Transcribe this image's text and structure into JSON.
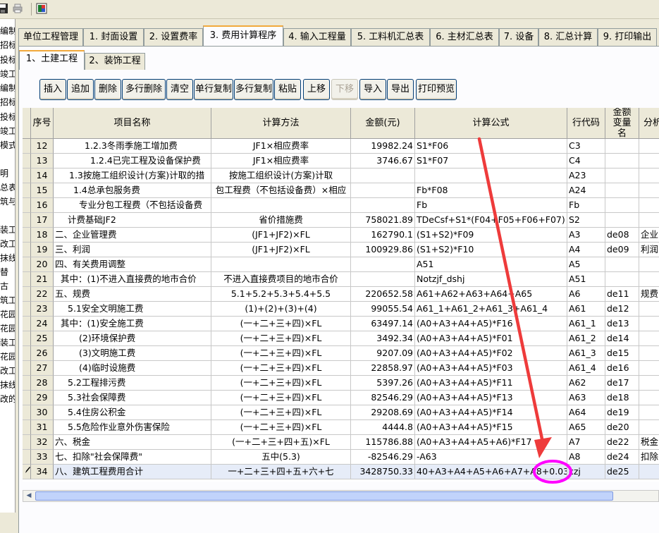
{
  "toolbar": {
    "icons": [
      "save-icon",
      "print-icon",
      "export-icon"
    ]
  },
  "left_panel": {
    "items": [
      "编制",
      "招标",
      "投标",
      "竣工",
      "编制",
      "招标",
      "投标",
      "竣工",
      "模式",
      "",
      "明",
      "总表",
      "筑与",
      "",
      "装工",
      "改工",
      "抹线",
      "替",
      "古",
      "筑工",
      "花园",
      "花园",
      "装工",
      "花园",
      "改工",
      "抹线",
      "改的"
    ]
  },
  "top_tabs": [
    "单位工程管理",
    "1. 封面设置",
    "2. 设置费率",
    "3. 费用计算程序",
    "4. 输入工程量",
    "5. 工料机汇总表",
    "6. 主材汇总表",
    "7. 设备",
    "8. 汇总计算",
    "9. 打印输出"
  ],
  "sub_tabs": [
    "1、土建工程",
    "2、装饰工程"
  ],
  "buttons": [
    "插入",
    "追加",
    "删除",
    "多行删除",
    "清空",
    "单行复制",
    "多行复制",
    "粘贴",
    "上移",
    "下移",
    "导入",
    "导出",
    "打印预览"
  ],
  "table": {
    "headers": [
      "序号",
      "项目名称",
      "计算方法",
      "金额(元)",
      "计算公式",
      "行代码",
      "金额变量名",
      "分析"
    ],
    "rows": [
      {
        "no": "12",
        "name": "1.2.3冬雨季施工增加费",
        "method": "JF1×相应费率",
        "amount": "19982.24",
        "formula": "S1*F06",
        "code": "C3",
        "var": "",
        "analysis": ""
      },
      {
        "no": "13",
        "name": "1.2.4已完工程及设备保护费",
        "method": "JF1×相应费率",
        "amount": "3746.67",
        "formula": "S1*F07",
        "code": "C4",
        "var": "",
        "analysis": ""
      },
      {
        "no": "14",
        "name": "1.3按施工组织设计(方案)计取的措",
        "method": "按施工组织设计(方案)计取",
        "amount": "",
        "formula": "",
        "code": "A23",
        "var": "",
        "analysis": ""
      },
      {
        "no": "15",
        "name": "1.4总承包服务费",
        "method": "包工程费（不包括设备费）×相应",
        "amount": "",
        "formula": "Fb*F08",
        "code": "A24",
        "var": "",
        "analysis": ""
      },
      {
        "no": "16",
        "name": "专业分包工程费（不包括设备费",
        "method": "",
        "amount": "",
        "formula": "Fb",
        "code": "Fb",
        "var": "",
        "analysis": ""
      },
      {
        "no": "17",
        "name": "计费基础JF2",
        "method": "省价措施费",
        "amount": "758021.89",
        "formula": "TDeCsf+S1*(F04+F05+F06+F07)",
        "code": "S2",
        "var": "",
        "analysis": ""
      },
      {
        "no": "18",
        "name": "二、企业管理费",
        "method": "(JF1+JF2)×FL",
        "amount": "162790.1",
        "formula": "(S1+S2)*F09",
        "code": "A3",
        "var": "de08",
        "analysis": "企业"
      },
      {
        "no": "19",
        "name": "三、利润",
        "method": "(JF1+JF2)×FL",
        "amount": "100929.86",
        "formula": "(S1+S2)*F10",
        "code": "A4",
        "var": "de09",
        "analysis": "利润"
      },
      {
        "no": "20",
        "name": "四、有关费用调整",
        "method": "",
        "amount": "",
        "formula": "A51",
        "code": "A5",
        "var": "",
        "analysis": ""
      },
      {
        "no": "21",
        "name": "其中：(1)不进入直接费的地市合价",
        "method": "不进入直接费项目的地市合价",
        "amount": "",
        "formula": "Notzjf_dshj",
        "code": "A51",
        "var": "",
        "analysis": ""
      },
      {
        "no": "22",
        "name": "五、规费",
        "method": "5.1+5.2+5.3+5.4+5.5",
        "amount": "220652.58",
        "formula": "A61+A62+A63+A64+A65",
        "code": "A6",
        "var": "de11",
        "analysis": "规费"
      },
      {
        "no": "23",
        "name": "5.1安全文明施工费",
        "method": "(1)+(2)+(3)+(4)",
        "amount": "99055.54",
        "formula": "A61_1+A61_2+A61_3+A61_4",
        "code": "A61",
        "var": "de12",
        "analysis": ""
      },
      {
        "no": "24",
        "name": "其中：(1)安全施工费",
        "method": "(一+二+三+四)×FL",
        "amount": "63497.14",
        "formula": "(A0+A3+A4+A5)*F16",
        "code": "A61_1",
        "var": "de13",
        "analysis": ""
      },
      {
        "no": "25",
        "name": "(2)环境保护费",
        "method": "(一+二+三+四)×FL",
        "amount": "3492.34",
        "formula": "(A0+A3+A4+A5)*F01",
        "code": "A61_2",
        "var": "de14",
        "analysis": ""
      },
      {
        "no": "26",
        "name": "(3)文明施工费",
        "method": "(一+二+三+四)×FL",
        "amount": "9207.09",
        "formula": "(A0+A3+A4+A5)*F02",
        "code": "A61_3",
        "var": "de15",
        "analysis": ""
      },
      {
        "no": "27",
        "name": "(4)临时设施费",
        "method": "(一+二+三+四)×FL",
        "amount": "22858.97",
        "formula": "(A0+A3+A4+A5)*F03",
        "code": "A61_4",
        "var": "de16",
        "analysis": ""
      },
      {
        "no": "28",
        "name": "5.2工程排污费",
        "method": "(一+二+三+四)×FL",
        "amount": "5397.26",
        "formula": "(A0+A3+A4+A5)*F11",
        "code": "A62",
        "var": "de17",
        "analysis": ""
      },
      {
        "no": "29",
        "name": "5.3社会保障费",
        "method": "(一+二+三+四)×FL",
        "amount": "82546.29",
        "formula": "(A0+A3+A4+A5)*F13",
        "code": "A63",
        "var": "de18",
        "analysis": ""
      },
      {
        "no": "30",
        "name": "5.4住房公积金",
        "method": "(一+二+三+四)×FL",
        "amount": "29208.69",
        "formula": "(A0+A3+A4+A5)*F14",
        "code": "A64",
        "var": "de19",
        "analysis": ""
      },
      {
        "no": "31",
        "name": "5.5危险作业意外伤害保险",
        "method": "(一+二+三+四)×FL",
        "amount": "4444.8",
        "formula": "(A0+A3+A4+A5)*F15",
        "code": "A65",
        "var": "de20",
        "analysis": ""
      },
      {
        "no": "32",
        "name": "六、税金",
        "method": "(一+二+三+四+五)×FL",
        "amount": "115786.88",
        "formula": "(A0+A3+A4+A5+A6)*F17",
        "code": "A7",
        "var": "de22",
        "analysis": "税金"
      },
      {
        "no": "33",
        "name": "七、扣除\"社会保障费\"",
        "method": "五中(5.3)",
        "amount": "-82546.29",
        "formula": "-A63",
        "code": "A8",
        "var": "de24",
        "analysis": "扣除"
      },
      {
        "no": "34",
        "name": "八、建筑工程费用合计",
        "method": "一+二+三+四+五+六+七",
        "amount": "3428750.33",
        "formula": "40+A3+A4+A5+A6+A7+A8+0.03",
        "code": "czj",
        "var": "de25",
        "analysis": ""
      }
    ]
  },
  "annotation": {
    "color_arrow": "#ee3b3b",
    "color_ellipse": "#ff00ff"
  }
}
